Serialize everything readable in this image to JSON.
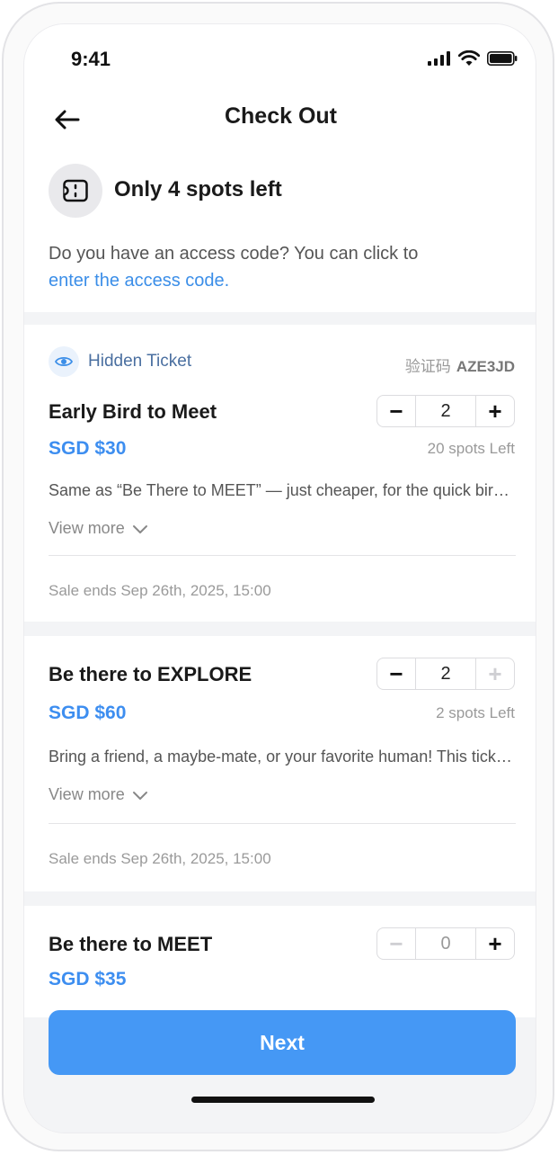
{
  "status": {
    "time": "9:41"
  },
  "header": {
    "title": "Check Out"
  },
  "availability": {
    "text": "Only 4 spots left"
  },
  "access": {
    "prompt": "Do you have an access code? You can click to",
    "link": "enter the access code."
  },
  "tickets": [
    {
      "badge": "Hidden Ticket",
      "code_label": "验证码",
      "code": "AZE3JD",
      "name": "Early Bird to Meet",
      "price": "SGD $30",
      "quantity": "2",
      "spots_left": "20 spots Left",
      "description": "Same as “Be There to MEET” — just cheaper, for the quick birds who booked early!",
      "view_more": "View more",
      "sale_ends": "Sale ends Sep 26th, 2025, 15:00"
    },
    {
      "name": "Be there to EXPLORE",
      "price": "SGD $60",
      "quantity": "2",
      "spots_left": "2 spots Left",
      "description": "Bring a friend, a maybe-mate, or your favorite human! This ticket is for two.",
      "view_more": "View more",
      "sale_ends": "Sale ends Sep 26th, 2025, 15:00"
    },
    {
      "name": "Be there to MEET",
      "price": "SGD $35",
      "quantity": "0"
    }
  ],
  "footer": {
    "next_label": "Next"
  },
  "colors": {
    "accent": "#4598f5",
    "price": "#3d8ef0",
    "link": "#3b8ee8"
  }
}
